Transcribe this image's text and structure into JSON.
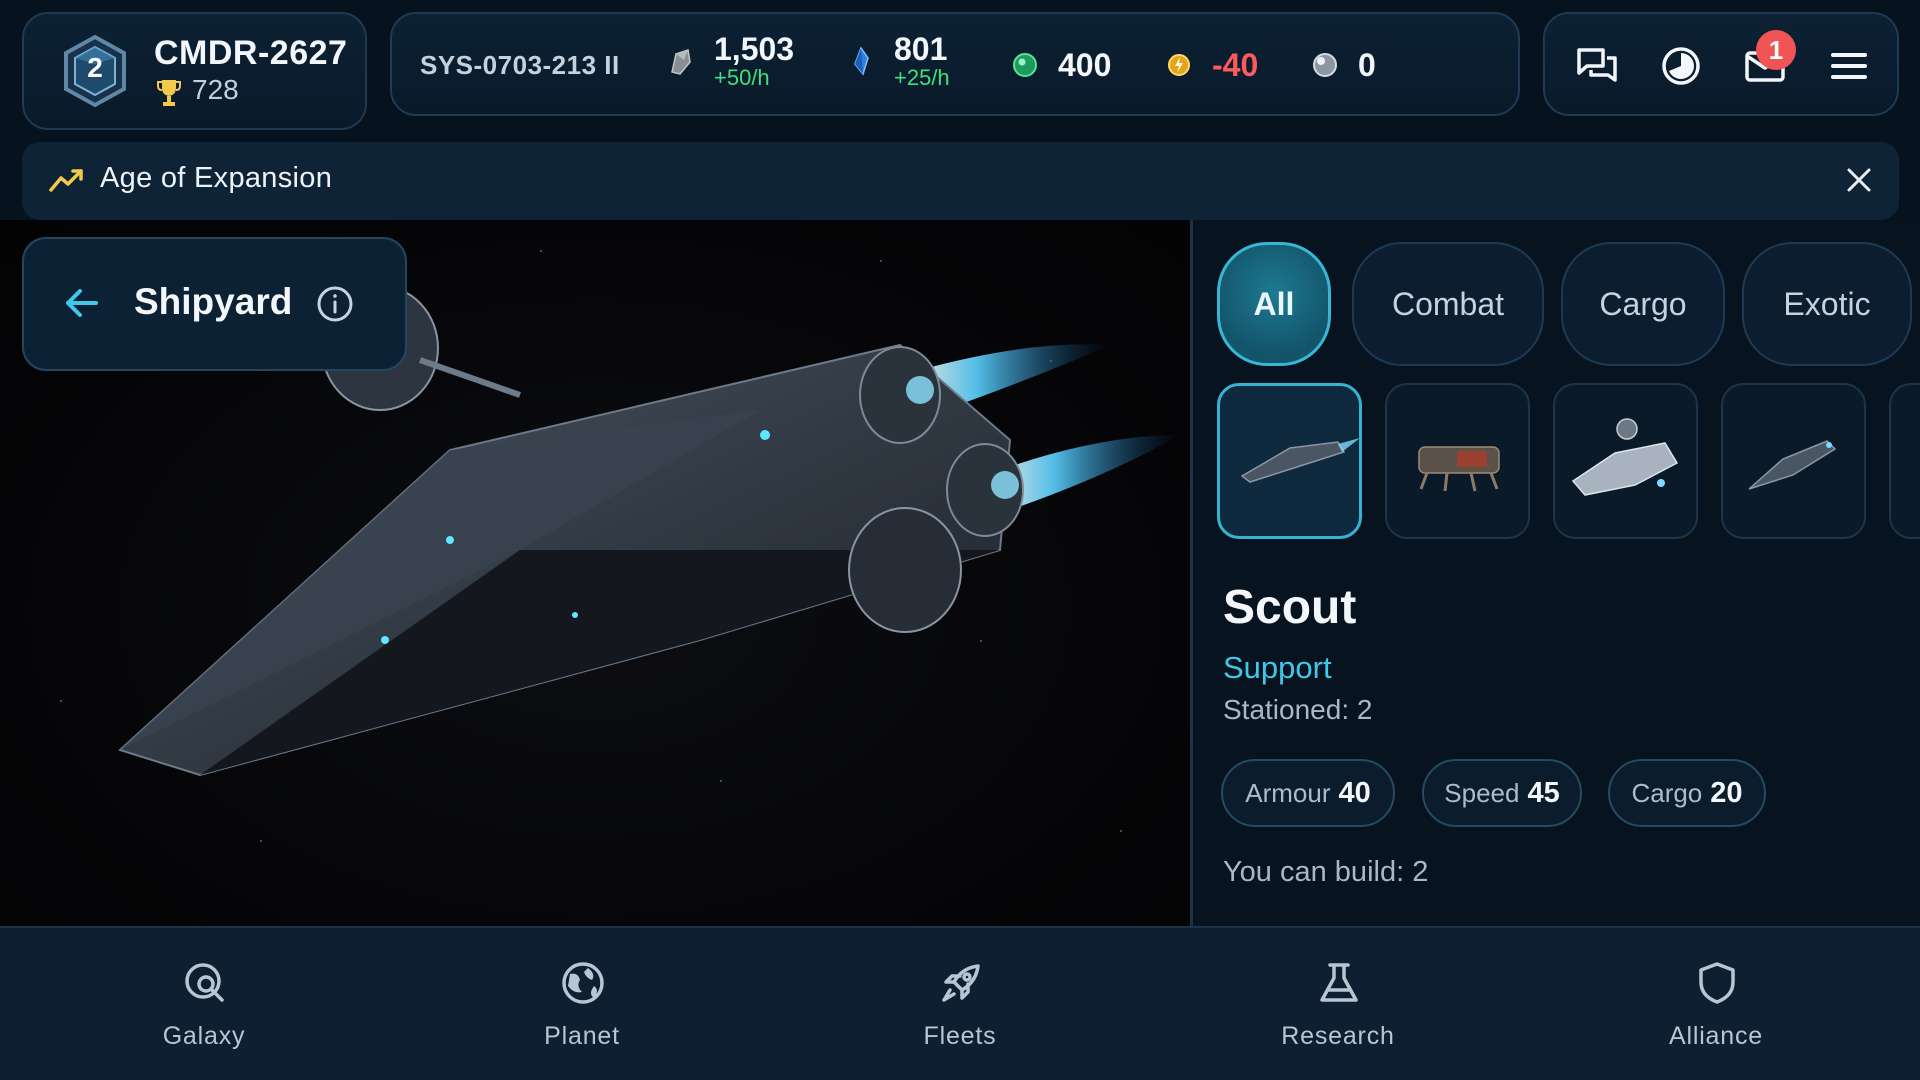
{
  "player": {
    "rank": "2",
    "name": "CMDR-2627",
    "score": "728"
  },
  "resources": {
    "system": "SYS-0703-213 II",
    "metal": {
      "value": "1,503",
      "rate": "+50/h",
      "icon": "metal-ore-icon"
    },
    "crystal": {
      "value": "801",
      "rate": "+25/h",
      "icon": "crystal-icon"
    },
    "deuterium": {
      "value": "400",
      "icon": "deuterium-icon"
    },
    "energy": {
      "value": "-40",
      "icon": "energy-icon"
    },
    "premium": {
      "value": "0",
      "icon": "premium-orb-icon"
    }
  },
  "actions": {
    "notifications_count": "1",
    "icons": [
      "chat-icon",
      "timer-icon",
      "mail-icon",
      "menu-icon"
    ]
  },
  "era": {
    "title": "Age of Expansion"
  },
  "shipyard": {
    "title": "Shipyard"
  },
  "tabs": [
    {
      "label": "All"
    },
    {
      "label": "Combat"
    },
    {
      "label": "Cargo"
    },
    {
      "label": "Exotic"
    }
  ],
  "ship": {
    "name": "Scout",
    "role": "Support",
    "stationed": "Stationed: 2",
    "stats": [
      {
        "label": "Armour",
        "value": "40"
      },
      {
        "label": "Speed",
        "value": "45"
      },
      {
        "label": "Cargo",
        "value": "20"
      }
    ],
    "can_build": "You can build: 2"
  },
  "nav": [
    {
      "label": "Galaxy",
      "icon": "galaxy-search-icon"
    },
    {
      "label": "Planet",
      "icon": "planet-icon"
    },
    {
      "label": "Fleets",
      "icon": "rocket-icon"
    },
    {
      "label": "Research",
      "icon": "flask-icon"
    },
    {
      "label": "Alliance",
      "icon": "shield-icon"
    }
  ],
  "colors": {
    "accent": "#38b6d4",
    "positive": "#3fe07a",
    "negative": "#ff5a5a",
    "badge": "#f05454",
    "gold": "#f2c94c"
  }
}
